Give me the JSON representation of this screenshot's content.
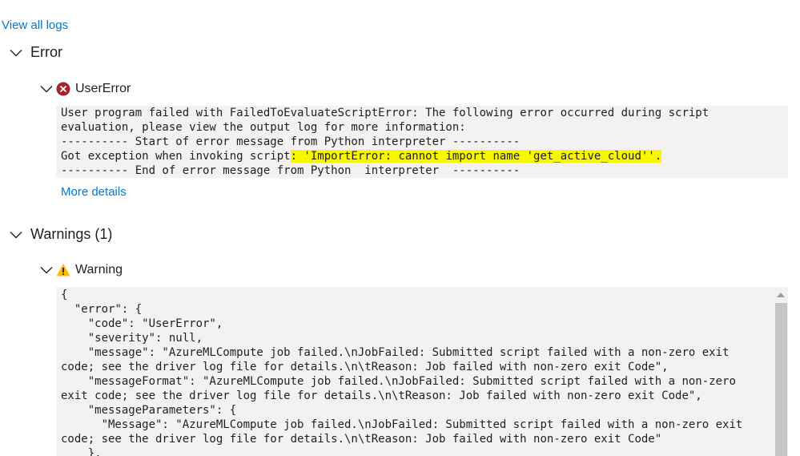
{
  "links": {
    "view_all_logs": "View all logs",
    "more_details": "More details"
  },
  "error_section": {
    "title": "Error",
    "item": {
      "title": "UserError",
      "icon": "error-circle-icon",
      "icon_color": "#a4262c",
      "lines": {
        "l1": "User program failed with FailedToEvaluateScriptError: The following error occurred during script",
        "l2": "evaluation, please view the output log for more information:",
        "l3": "---------- Start of error message from Python interpreter ----------",
        "l4_pre": "Got exception when invoking script",
        "l4_highlighted": ": 'ImportError: cannot import name 'get_active_cloud''.",
        "l5": "---------- End of error message from Python  interpreter  ----------"
      }
    }
  },
  "warnings_section": {
    "title": "Warnings (1)",
    "item": {
      "title": "Warning",
      "icon": "warning-triangle-icon",
      "icon_color": "#ffb900",
      "json_lines": [
        "{",
        "  \"error\": {",
        "    \"code\": \"UserError\",",
        "    \"severity\": null,",
        "    \"message\": \"AzureMLCompute job failed.\\nJobFailed: Submitted script failed with a non-zero exit",
        "code; see the driver log file for details.\\n\\tReason: Job failed with non-zero exit Code\",",
        "    \"messageFormat\": \"AzureMLCompute job failed.\\nJobFailed: Submitted script failed with a non-zero",
        "exit code; see the driver log file for details.\\n\\tReason: Job failed with non-zero exit Code\",",
        "    \"messageParameters\": {",
        "      \"Message\": \"AzureMLCompute job failed.\\nJobFailed: Submitted script failed with a non-zero exit",
        "code; see the driver log file for details.\\n\\tReason: Job failed with non-zero exit Code\"",
        "    },"
      ]
    }
  },
  "colors": {
    "link": "#0078d4",
    "highlight": "#f7f700",
    "code_background": "#f3f2f1"
  }
}
